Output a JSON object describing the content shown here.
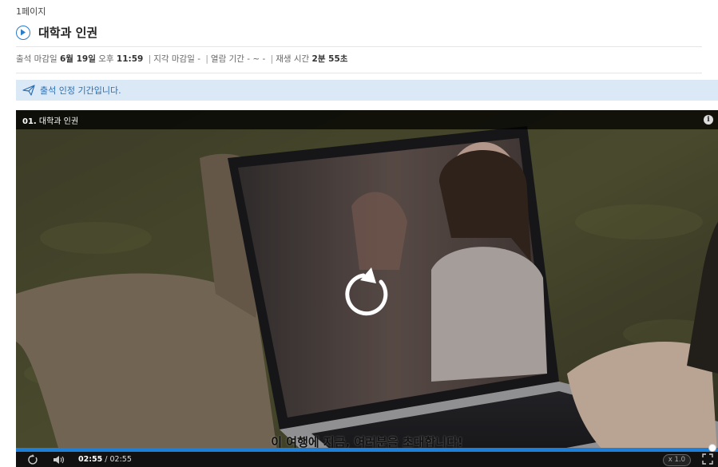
{
  "page": {
    "label": "1페이지"
  },
  "lesson": {
    "title": "대학과 인권"
  },
  "info": {
    "deadline_label": "출석 마감일",
    "deadline_date": "6월 19일",
    "deadline_ampm": "오후",
    "deadline_time": "11:59",
    "late_label": "지각 마감일",
    "late_value": "-",
    "view_label": "열람 기간",
    "view_value": "- ~ -",
    "play_label": "재생 시간",
    "play_value": "2분 55초"
  },
  "notice": {
    "text": "출석 인정 기간입니다."
  },
  "player": {
    "clip_number": "01.",
    "clip_title": "대학과 인권",
    "info_glyph": "i",
    "subtitle": "이 여행에 지금, 여러분을 초대합니다!",
    "current_time": "02:55",
    "total_time": "02:55",
    "progress": 1.0,
    "speed": "x 1.0"
  },
  "colors": {
    "accent": "#1e7fd8",
    "notice_bg": "#dbe9f7",
    "notice_text": "#2a6fb5"
  },
  "icons": {
    "title": "play-circle-icon",
    "notice": "paper-plane-icon",
    "center": "replay-icon",
    "volume": "volume-icon",
    "fullscreen": "fullscreen-icon"
  }
}
